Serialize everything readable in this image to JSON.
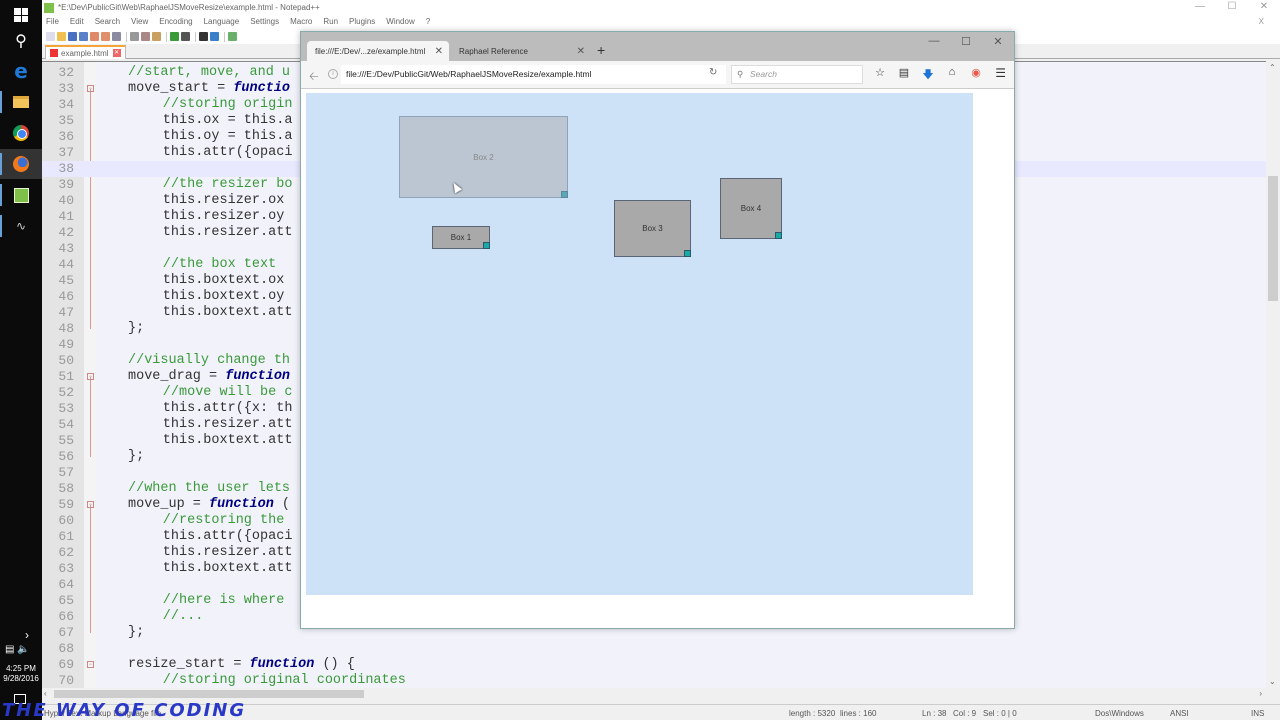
{
  "taskbar": {
    "icons": [
      "windows-start",
      "search",
      "edge",
      "file-explorer",
      "chrome",
      "firefox",
      "notepad-plus-plus",
      "cmd-tool"
    ],
    "time": "4:25 PM",
    "date": "9/28/2016"
  },
  "notepad": {
    "title": "*E:\\Dev\\PublicGit\\Web\\RaphaelJSMoveResize\\example.html - Notepad++",
    "menu": [
      "File",
      "Edit",
      "Search",
      "View",
      "Encoding",
      "Language",
      "Settings",
      "Macro",
      "Run",
      "Plugins",
      "Window",
      "?"
    ],
    "tab_label": "example.html",
    "window_controls": [
      "—",
      "☐",
      "✕"
    ],
    "doc_close": "X",
    "lines": [
      {
        "n": "32",
        "indent": 4,
        "parts": [
          {
            "t": "//start, move, and u",
            "c": "cmt"
          }
        ]
      },
      {
        "n": "33",
        "indent": 4,
        "fold": "-",
        "parts": [
          {
            "t": "move_start = ",
            "c": ""
          },
          {
            "t": "functio",
            "c": "kw"
          }
        ]
      },
      {
        "n": "34",
        "indent": 8,
        "parts": [
          {
            "t": "//storing origin",
            "c": "cmt"
          }
        ]
      },
      {
        "n": "35",
        "indent": 8,
        "parts": [
          {
            "t": "this.ox = this.a",
            "c": ""
          }
        ]
      },
      {
        "n": "36",
        "indent": 8,
        "parts": [
          {
            "t": "this.oy = this.a",
            "c": ""
          }
        ]
      },
      {
        "n": "37",
        "indent": 8,
        "parts": [
          {
            "t": "this.attr({opaci",
            "c": ""
          }
        ]
      },
      {
        "n": "38",
        "indent": 8,
        "current": true,
        "parts": []
      },
      {
        "n": "39",
        "indent": 8,
        "parts": [
          {
            "t": "//the resizer bo",
            "c": "cmt"
          }
        ]
      },
      {
        "n": "40",
        "indent": 8,
        "parts": [
          {
            "t": "this.resizer.ox ",
            "c": ""
          }
        ]
      },
      {
        "n": "41",
        "indent": 8,
        "parts": [
          {
            "t": "this.resizer.oy ",
            "c": ""
          }
        ]
      },
      {
        "n": "42",
        "indent": 8,
        "parts": [
          {
            "t": "this.resizer.att",
            "c": ""
          }
        ]
      },
      {
        "n": "43",
        "indent": 0,
        "parts": []
      },
      {
        "n": "44",
        "indent": 8,
        "parts": [
          {
            "t": "//the box text",
            "c": "cmt"
          }
        ]
      },
      {
        "n": "45",
        "indent": 8,
        "parts": [
          {
            "t": "this.boxtext.ox ",
            "c": ""
          }
        ]
      },
      {
        "n": "46",
        "indent": 8,
        "parts": [
          {
            "t": "this.boxtext.oy ",
            "c": ""
          }
        ]
      },
      {
        "n": "47",
        "indent": 8,
        "parts": [
          {
            "t": "this.boxtext.att",
            "c": ""
          }
        ]
      },
      {
        "n": "48",
        "indent": 4,
        "parts": [
          {
            "t": "};",
            "c": ""
          }
        ]
      },
      {
        "n": "49",
        "indent": 0,
        "parts": []
      },
      {
        "n": "50",
        "indent": 4,
        "parts": [
          {
            "t": "//visually change th",
            "c": "cmt"
          }
        ]
      },
      {
        "n": "51",
        "indent": 4,
        "fold": "-",
        "parts": [
          {
            "t": "move_drag = ",
            "c": ""
          },
          {
            "t": "function",
            "c": "kw"
          }
        ]
      },
      {
        "n": "52",
        "indent": 8,
        "parts": [
          {
            "t": "//move will be c",
            "c": "cmt"
          }
        ]
      },
      {
        "n": "53",
        "indent": 8,
        "parts": [
          {
            "t": "this.attr({x: th",
            "c": ""
          }
        ]
      },
      {
        "n": "54",
        "indent": 8,
        "parts": [
          {
            "t": "this.resizer.att",
            "c": ""
          }
        ]
      },
      {
        "n": "55",
        "indent": 8,
        "parts": [
          {
            "t": "this.boxtext.att",
            "c": ""
          }
        ]
      },
      {
        "n": "56",
        "indent": 4,
        "parts": [
          {
            "t": "};",
            "c": ""
          }
        ]
      },
      {
        "n": "57",
        "indent": 0,
        "parts": []
      },
      {
        "n": "58",
        "indent": 4,
        "parts": [
          {
            "t": "//when the user lets",
            "c": "cmt"
          }
        ]
      },
      {
        "n": "59",
        "indent": 4,
        "fold": "-",
        "parts": [
          {
            "t": "move_up = ",
            "c": ""
          },
          {
            "t": "function",
            "c": "kw"
          },
          {
            "t": " (",
            "c": ""
          }
        ]
      },
      {
        "n": "60",
        "indent": 8,
        "parts": [
          {
            "t": "//restoring the ",
            "c": "cmt"
          }
        ]
      },
      {
        "n": "61",
        "indent": 8,
        "parts": [
          {
            "t": "this.attr({opaci",
            "c": ""
          }
        ]
      },
      {
        "n": "62",
        "indent": 8,
        "parts": [
          {
            "t": "this.resizer.att",
            "c": ""
          }
        ]
      },
      {
        "n": "63",
        "indent": 8,
        "parts": [
          {
            "t": "this.boxtext.att",
            "c": ""
          }
        ]
      },
      {
        "n": "64",
        "indent": 0,
        "parts": []
      },
      {
        "n": "65",
        "indent": 8,
        "parts": [
          {
            "t": "//here is where ",
            "c": "cmt"
          }
        ]
      },
      {
        "n": "66",
        "indent": 8,
        "parts": [
          {
            "t": "//...",
            "c": "cmt"
          }
        ]
      },
      {
        "n": "67",
        "indent": 4,
        "parts": [
          {
            "t": "};",
            "c": ""
          }
        ]
      },
      {
        "n": "68",
        "indent": 0,
        "parts": []
      },
      {
        "n": "69",
        "indent": 4,
        "fold": "-",
        "parts": [
          {
            "t": "resize_start = ",
            "c": ""
          },
          {
            "t": "function",
            "c": "kw"
          },
          {
            "t": " () {",
            "c": ""
          }
        ]
      },
      {
        "n": "70",
        "indent": 8,
        "parts": [
          {
            "t": "//storing original coordinates",
            "c": "cmt"
          }
        ]
      }
    ],
    "status": {
      "language": "Hyper Text Markup Language file",
      "length": "length : 5320",
      "lines": "lines : 160",
      "ln": "Ln : 38",
      "col": "Col : 9",
      "sel": "Sel : 0 | 0",
      "eol": "Dos\\Windows",
      "encoding": "ANSI",
      "mode": "INS"
    }
  },
  "firefox": {
    "tabs": [
      {
        "label": "file:///E:/Dev/...ze/example.html",
        "active": true
      },
      {
        "label": "Raphael Reference",
        "active": false
      }
    ],
    "new_tab": "+",
    "window_controls": [
      "—",
      "☐",
      "✕"
    ],
    "url": "file:///E:/Dev/PublicGit/Web/RaphaelJSMoveResize/example.html",
    "search_placeholder": "Search",
    "toolbar_icons": [
      "bookmark-star",
      "reading-list",
      "downloads",
      "home",
      "pocket"
    ]
  },
  "canvas": {
    "boxes": [
      {
        "label": "Box 1",
        "dragging": false
      },
      {
        "label": "Box 2",
        "dragging": true
      },
      {
        "label": "Box 3",
        "dragging": false
      },
      {
        "label": "Box 4",
        "dragging": false
      }
    ]
  },
  "watermark": "THE WAY OF CODING"
}
